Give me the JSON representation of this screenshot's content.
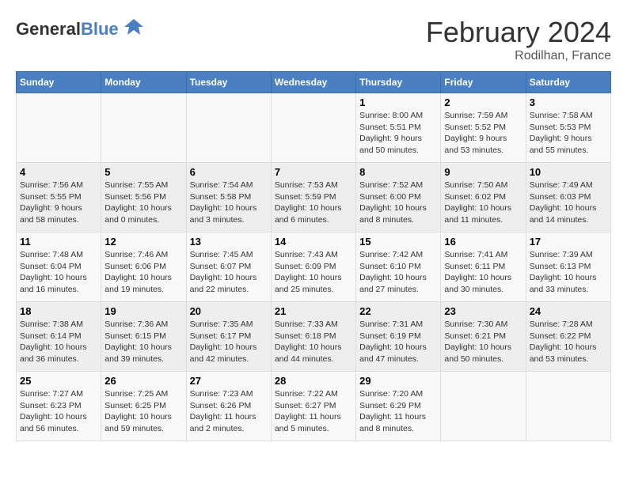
{
  "logo": {
    "general": "General",
    "blue": "Blue"
  },
  "title": {
    "month": "February 2024",
    "location": "Rodilhan, France"
  },
  "days_of_week": [
    "Sunday",
    "Monday",
    "Tuesday",
    "Wednesday",
    "Thursday",
    "Friday",
    "Saturday"
  ],
  "weeks": [
    [
      {
        "day": "",
        "info": ""
      },
      {
        "day": "",
        "info": ""
      },
      {
        "day": "",
        "info": ""
      },
      {
        "day": "",
        "info": ""
      },
      {
        "day": "1",
        "info": "Sunrise: 8:00 AM\nSunset: 5:51 PM\nDaylight: 9 hours\nand 50 minutes."
      },
      {
        "day": "2",
        "info": "Sunrise: 7:59 AM\nSunset: 5:52 PM\nDaylight: 9 hours\nand 53 minutes."
      },
      {
        "day": "3",
        "info": "Sunrise: 7:58 AM\nSunset: 5:53 PM\nDaylight: 9 hours\nand 55 minutes."
      }
    ],
    [
      {
        "day": "4",
        "info": "Sunrise: 7:56 AM\nSunset: 5:55 PM\nDaylight: 9 hours\nand 58 minutes."
      },
      {
        "day": "5",
        "info": "Sunrise: 7:55 AM\nSunset: 5:56 PM\nDaylight: 10 hours\nand 0 minutes."
      },
      {
        "day": "6",
        "info": "Sunrise: 7:54 AM\nSunset: 5:58 PM\nDaylight: 10 hours\nand 3 minutes."
      },
      {
        "day": "7",
        "info": "Sunrise: 7:53 AM\nSunset: 5:59 PM\nDaylight: 10 hours\nand 6 minutes."
      },
      {
        "day": "8",
        "info": "Sunrise: 7:52 AM\nSunset: 6:00 PM\nDaylight: 10 hours\nand 8 minutes."
      },
      {
        "day": "9",
        "info": "Sunrise: 7:50 AM\nSunset: 6:02 PM\nDaylight: 10 hours\nand 11 minutes."
      },
      {
        "day": "10",
        "info": "Sunrise: 7:49 AM\nSunset: 6:03 PM\nDaylight: 10 hours\nand 14 minutes."
      }
    ],
    [
      {
        "day": "11",
        "info": "Sunrise: 7:48 AM\nSunset: 6:04 PM\nDaylight: 10 hours\nand 16 minutes."
      },
      {
        "day": "12",
        "info": "Sunrise: 7:46 AM\nSunset: 6:06 PM\nDaylight: 10 hours\nand 19 minutes."
      },
      {
        "day": "13",
        "info": "Sunrise: 7:45 AM\nSunset: 6:07 PM\nDaylight: 10 hours\nand 22 minutes."
      },
      {
        "day": "14",
        "info": "Sunrise: 7:43 AM\nSunset: 6:09 PM\nDaylight: 10 hours\nand 25 minutes."
      },
      {
        "day": "15",
        "info": "Sunrise: 7:42 AM\nSunset: 6:10 PM\nDaylight: 10 hours\nand 27 minutes."
      },
      {
        "day": "16",
        "info": "Sunrise: 7:41 AM\nSunset: 6:11 PM\nDaylight: 10 hours\nand 30 minutes."
      },
      {
        "day": "17",
        "info": "Sunrise: 7:39 AM\nSunset: 6:13 PM\nDaylight: 10 hours\nand 33 minutes."
      }
    ],
    [
      {
        "day": "18",
        "info": "Sunrise: 7:38 AM\nSunset: 6:14 PM\nDaylight: 10 hours\nand 36 minutes."
      },
      {
        "day": "19",
        "info": "Sunrise: 7:36 AM\nSunset: 6:15 PM\nDaylight: 10 hours\nand 39 minutes."
      },
      {
        "day": "20",
        "info": "Sunrise: 7:35 AM\nSunset: 6:17 PM\nDaylight: 10 hours\nand 42 minutes."
      },
      {
        "day": "21",
        "info": "Sunrise: 7:33 AM\nSunset: 6:18 PM\nDaylight: 10 hours\nand 44 minutes."
      },
      {
        "day": "22",
        "info": "Sunrise: 7:31 AM\nSunset: 6:19 PM\nDaylight: 10 hours\nand 47 minutes."
      },
      {
        "day": "23",
        "info": "Sunrise: 7:30 AM\nSunset: 6:21 PM\nDaylight: 10 hours\nand 50 minutes."
      },
      {
        "day": "24",
        "info": "Sunrise: 7:28 AM\nSunset: 6:22 PM\nDaylight: 10 hours\nand 53 minutes."
      }
    ],
    [
      {
        "day": "25",
        "info": "Sunrise: 7:27 AM\nSunset: 6:23 PM\nDaylight: 10 hours\nand 56 minutes."
      },
      {
        "day": "26",
        "info": "Sunrise: 7:25 AM\nSunset: 6:25 PM\nDaylight: 10 hours\nand 59 minutes."
      },
      {
        "day": "27",
        "info": "Sunrise: 7:23 AM\nSunset: 6:26 PM\nDaylight: 11 hours\nand 2 minutes."
      },
      {
        "day": "28",
        "info": "Sunrise: 7:22 AM\nSunset: 6:27 PM\nDaylight: 11 hours\nand 5 minutes."
      },
      {
        "day": "29",
        "info": "Sunrise: 7:20 AM\nSunset: 6:29 PM\nDaylight: 11 hours\nand 8 minutes."
      },
      {
        "day": "",
        "info": ""
      },
      {
        "day": "",
        "info": ""
      }
    ]
  ]
}
